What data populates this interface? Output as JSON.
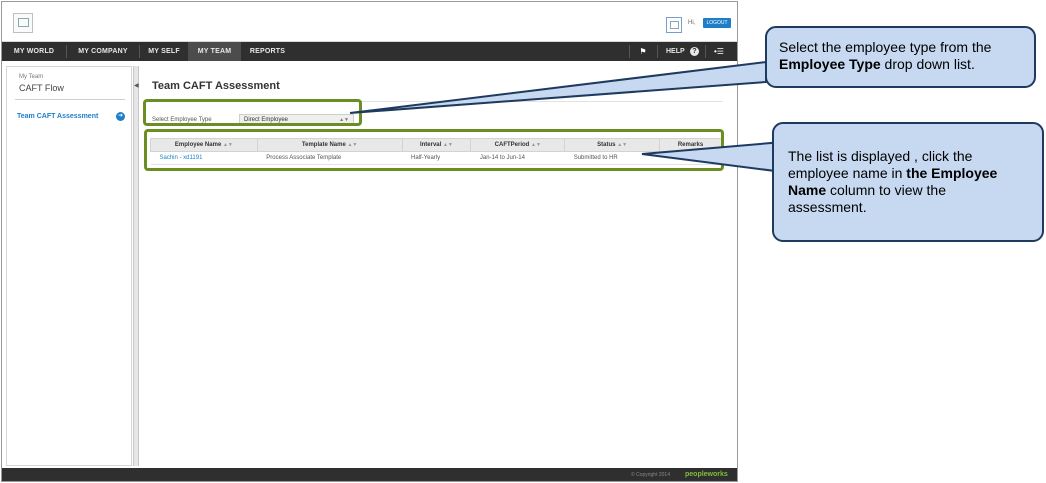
{
  "header": {
    "greeting": "Hi,",
    "logout_label": "LOGOUT"
  },
  "nav": {
    "items": [
      "MY WORLD",
      "MY COMPANY",
      "MY SELF",
      "MY TEAM",
      "REPORTS"
    ],
    "active": "MY TEAM",
    "help_label": "HELP"
  },
  "sidebar": {
    "section_label": "My Team",
    "section_title": "CAFT Flow",
    "link_label": "Team CAFT Assessment"
  },
  "main": {
    "title": "Team CAFT Assessment",
    "filter_label": "Select Employee Type",
    "employee_type_value": "Direct Employee",
    "table": {
      "columns": [
        "Employee Name",
        "Template Name",
        "Interval",
        "CAFTPeriod",
        "Status",
        "Remarks"
      ],
      "rows": [
        [
          "Sachin - xd1191",
          "Process Associate Template",
          "Half-Yearly",
          "Jan-14 to Jun-14",
          "Submitted to HR",
          ""
        ]
      ]
    }
  },
  "footer": {
    "copyright": "© Copyright 2014",
    "brand": "peopleworks"
  },
  "callouts": {
    "first": {
      "pre": "Select the employee type  from the ",
      "bold": "Employee Type",
      "post": " drop down list."
    },
    "second": {
      "pre": "The list is displayed , click the employee name in ",
      "bold": "the Employee Name",
      "post": " column to view the assessment."
    }
  },
  "colors": {
    "highlight": "#6b8e23",
    "callout_fill": "#c6d9f1",
    "callout_border": "#1f3a5f",
    "link": "#1e7ec8",
    "nav_bg": "#2f2f2f"
  }
}
